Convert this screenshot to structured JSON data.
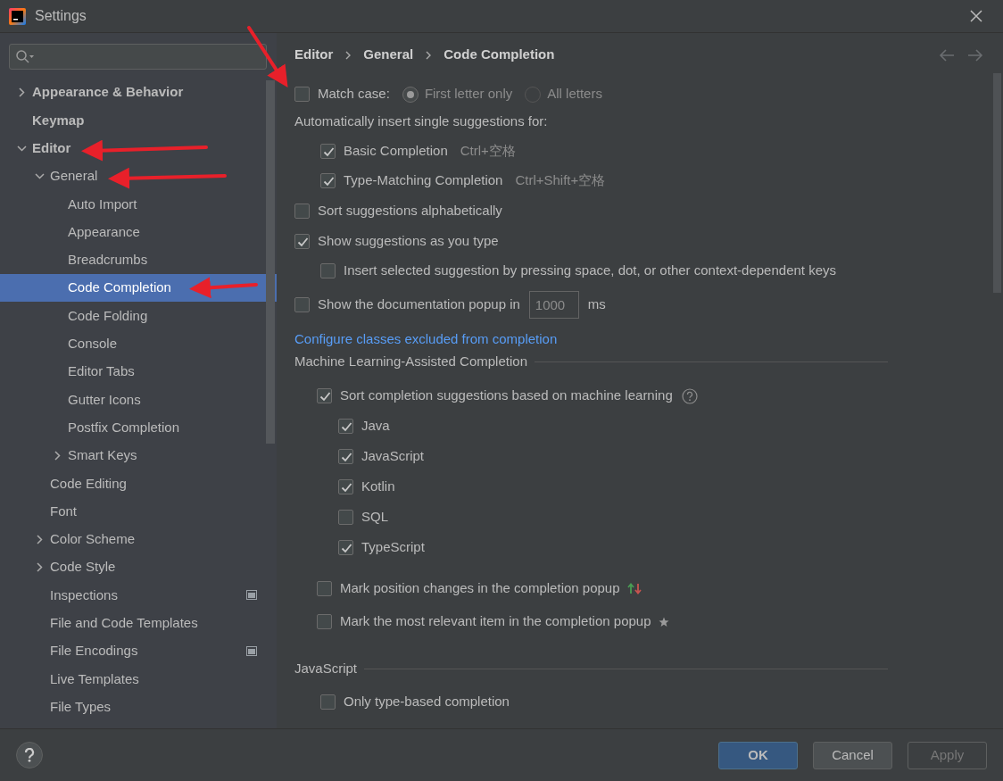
{
  "window": {
    "title": "Settings"
  },
  "sidebar": {
    "tree": [
      {
        "label": "Appearance & Behavior",
        "selected": false,
        "expanded": false
      },
      {
        "label": "Keymap",
        "selected": false
      },
      {
        "label": "Editor",
        "selected": false,
        "expanded": true,
        "children": [
          {
            "label": "General",
            "selected": false,
            "expanded": true,
            "children": [
              {
                "label": "Auto Import",
                "selected": false
              },
              {
                "label": "Appearance",
                "selected": false
              },
              {
                "label": "Breadcrumbs",
                "selected": false
              },
              {
                "label": "Code Completion",
                "selected": true
              },
              {
                "label": "Code Folding",
                "selected": false
              },
              {
                "label": "Console",
                "selected": false
              },
              {
                "label": "Editor Tabs",
                "selected": false
              },
              {
                "label": "Gutter Icons",
                "selected": false
              },
              {
                "label": "Postfix Completion",
                "selected": false
              },
              {
                "label": "Smart Keys",
                "selected": false,
                "expanded": false
              }
            ]
          },
          {
            "label": "Code Editing",
            "selected": false
          },
          {
            "label": "Font",
            "selected": false
          },
          {
            "label": "Color Scheme",
            "selected": false,
            "expanded": false
          },
          {
            "label": "Code Style",
            "selected": false,
            "expanded": false
          },
          {
            "label": "Inspections",
            "selected": false,
            "scope_icon": true
          },
          {
            "label": "File and Code Templates",
            "selected": false
          },
          {
            "label": "File Encodings",
            "selected": false,
            "scope_icon": true
          },
          {
            "label": "Live Templates",
            "selected": false
          },
          {
            "label": "File Types",
            "selected": false
          }
        ]
      }
    ]
  },
  "breadcrumbs": [
    "Editor",
    "General",
    "Code Completion"
  ],
  "match_case": {
    "label": "Match case:",
    "checked": false,
    "options": [
      {
        "label": "First letter only",
        "selected": true,
        "disabled": true
      },
      {
        "label": "All letters",
        "selected": false,
        "disabled": true
      }
    ]
  },
  "auto_insert": {
    "label": "Automatically insert single suggestions for:",
    "items": [
      {
        "label": "Basic Completion",
        "checked": true,
        "shortcut": "Ctrl+空格"
      },
      {
        "label": "Type-Matching Completion",
        "checked": true,
        "shortcut": "Ctrl+Shift+空格"
      }
    ]
  },
  "options": [
    {
      "label": "Sort suggestions alphabetically",
      "checked": false
    },
    {
      "label": "Show suggestions as you type",
      "checked": true,
      "children": [
        {
          "label": "Insert selected suggestion by pressing space, dot, or other context-dependent keys",
          "checked": false
        }
      ]
    }
  ],
  "doc_popup": {
    "label": "Show the documentation popup in",
    "checked": false,
    "value": "1000",
    "disabled": true,
    "unit": "ms"
  },
  "link": "Configure classes excluded from completion",
  "ml_section": {
    "title": "Machine Learning-Assisted Completion",
    "sort": {
      "label": "Sort completion suggestions based on machine learning",
      "checked": true
    },
    "languages": [
      {
        "label": "Java",
        "checked": true
      },
      {
        "label": "JavaScript",
        "checked": true
      },
      {
        "label": "Kotlin",
        "checked": true
      },
      {
        "label": "SQL",
        "checked": false
      },
      {
        "label": "TypeScript",
        "checked": true
      }
    ],
    "marks": [
      {
        "label": "Mark position changes in the completion popup",
        "checked": false,
        "kind": "arrows"
      },
      {
        "label": "Mark the most relevant item in the completion popup",
        "checked": false,
        "kind": "star"
      }
    ]
  },
  "js_section": {
    "title": "JavaScript",
    "items": [
      {
        "label": "Only type-based completion",
        "checked": false
      }
    ]
  },
  "buttons": [
    {
      "label": "OK",
      "kind": "primary"
    },
    {
      "label": "Cancel",
      "kind": "secondary"
    },
    {
      "label": "Apply",
      "kind": "disabled"
    }
  ]
}
